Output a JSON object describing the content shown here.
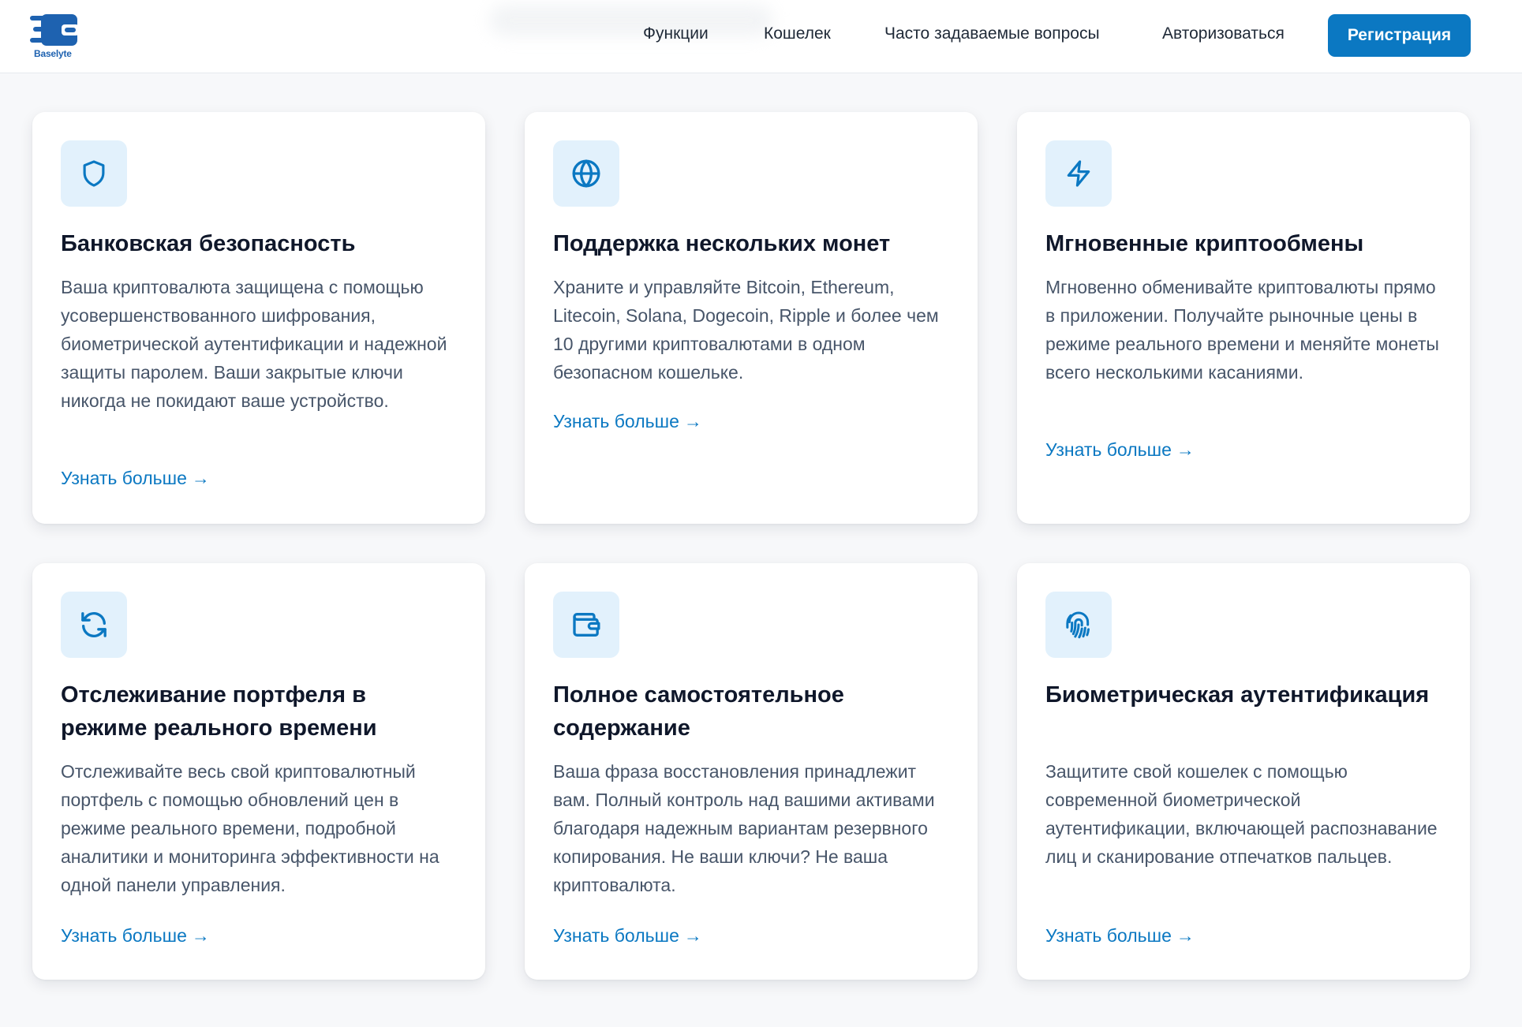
{
  "brand": {
    "name": "Baselyte",
    "primary_color": "#0b78c2",
    "logo_color": "#1e62b0",
    "icon_bg": "#e2f1fc"
  },
  "nav": {
    "items": [
      {
        "label": "Функции"
      },
      {
        "label": "Кошелек"
      },
      {
        "label": "Часто задаваемые вопросы"
      },
      {
        "label": "Авторизоваться"
      }
    ],
    "register_label": "Регистрация"
  },
  "features": [
    {
      "icon": "shield-icon",
      "title": "Банковская безопасность",
      "description": "Ваша криптовалюта защищена с помощью усовершенствованного шифрования, биометрической аутентификации и надежной защиты паролем. Ваши закрытые ключи никогда не покидают ваше устройство.",
      "link": "Узнать больше"
    },
    {
      "icon": "globe-icon",
      "title": "Поддержка нескольких монет",
      "description": "Храните и управляйте Bitcoin, Ethereum, Litecoin, Solana, Dogecoin, Ripple и более чем 10 другими криптовалютами в одном безопасном кошельке.",
      "link": "Узнать больше"
    },
    {
      "icon": "lightning-icon",
      "title": "Мгновенные криптообмены",
      "description": "Мгновенно обменивайте криптовалюты прямо в приложении. Получайте рыночные цены в режиме реального времени и меняйте монеты всего несколькими касаниями.",
      "link": "Узнать больше"
    },
    {
      "icon": "refresh-icon",
      "title": "Отслеживание портфеля в режиме реального времени",
      "description": "Отслеживайте весь свой криптовалютный портфель с помощью обновлений цен в режиме реального времени, подробной аналитики и мониторинга эффективности на одной панели управления.",
      "link": "Узнать больше"
    },
    {
      "icon": "wallet-icon",
      "title": "Полное самостоятельное содержание",
      "description": "Ваша фраза восстановления принадлежит вам. Полный контроль над вашими активами благодаря надежным вариантам резервного копирования. Не ваши ключи? Не ваша криптовалюта.",
      "link": "Узнать больше"
    },
    {
      "icon": "fingerprint-icon",
      "title": "Биометрическая аутентификация",
      "description": "Защитите свой кошелек с помощью современной биометрической аутентификации, включающей распознавание лиц и сканирование отпечатков пальцев.",
      "link": "Узнать больше"
    }
  ]
}
